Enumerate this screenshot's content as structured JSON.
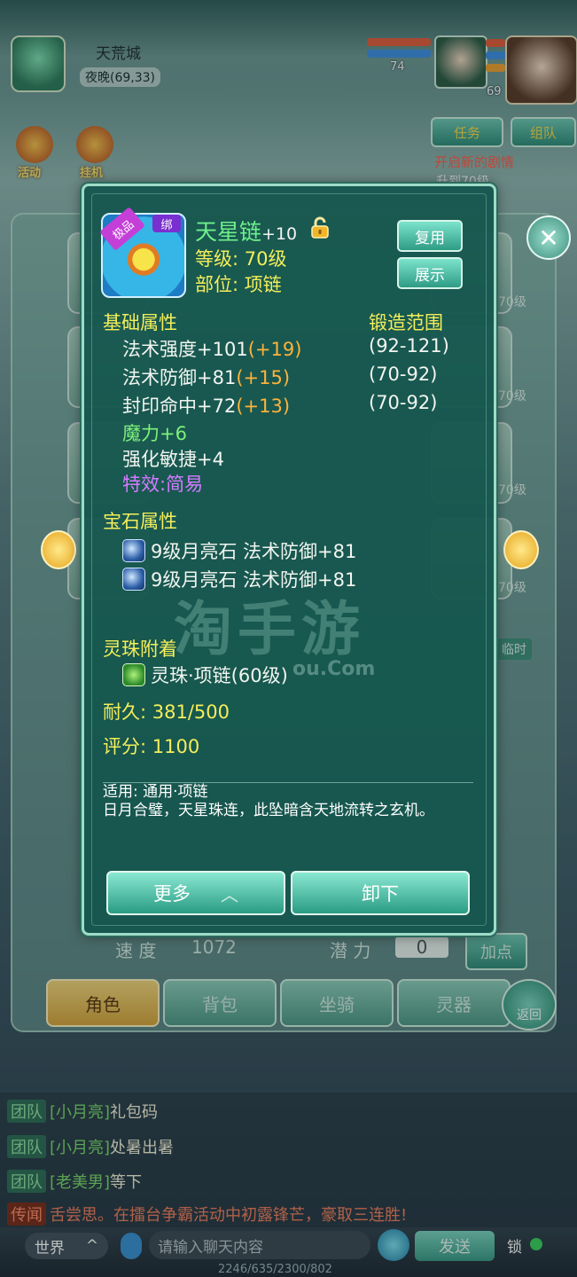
{
  "hud": {
    "city_name": "天荒城",
    "city_time": "夜晚(69,33)",
    "pet_level": "74",
    "hero_level": "69",
    "quest_btn_task": "任务",
    "quest_btn_team": "组队",
    "quest_title": "开启新的剧情",
    "quest_sub": "升到70级",
    "left_icon_1": "活动",
    "left_icon_2": "挂机"
  },
  "background_panel": {
    "slot_levels": [
      "70级",
      "70级",
      "70级",
      "70级"
    ],
    "stats": [
      {
        "label": "速 度",
        "value": "1072"
      },
      {
        "label": "潜 力",
        "value": "0"
      }
    ],
    "add_points_label": "加点",
    "temp_label": "临时",
    "tabs": [
      "角色",
      "背包",
      "坐骑",
      "灵器"
    ],
    "back_label": "返回"
  },
  "tooltip": {
    "rarity_tag": "极品",
    "bind_tag": "绑",
    "item_name": "天星链",
    "item_enhance": "+10",
    "level_line": "等级: 70级",
    "slot_line": "部位: 项链",
    "btn_reuse": "复用",
    "btn_show": "展示",
    "base_title": "基础属性",
    "forge_title": "锻造范围",
    "base_attrs": [
      {
        "text": "法术强度+101",
        "bonus": "(+19)",
        "range": "(92-121)"
      },
      {
        "text": "法术防御+81",
        "bonus": "(+15)",
        "range": "(70-92)"
      },
      {
        "text": "封印命中+72",
        "bonus": "(+13)",
        "range": "(70-92)"
      }
    ],
    "extra_magic": "魔力+6",
    "extra_agility": "强化敏捷+4",
    "special_effect": "特效:简易",
    "gem_title": "宝石属性",
    "gems": [
      "9级月亮石 法术防御+81",
      "9级月亮石 法术防御+81"
    ],
    "bead_title": "灵珠附着",
    "bead": "灵珠·项链(60级)",
    "durability": "耐久: 381/500",
    "score": "评分: 1100",
    "usage": "适用: 通用·项链",
    "description": "日月合璧，天星珠连，此坠暗含天地流转之玄机。",
    "btn_more": "更多",
    "btn_unequip": "卸下"
  },
  "watermark": {
    "main": "淘手游",
    "sub": "ou.Com"
  },
  "chat": {
    "lines": [
      {
        "channel": "团队",
        "name": "[小月亮]",
        "msg": "礼包码"
      },
      {
        "channel": "团队",
        "name": "[小月亮]",
        "msg": "处暑出暑"
      },
      {
        "channel": "团队",
        "name": "[老美男]",
        "msg": "等下"
      },
      {
        "channel": "传闻",
        "name": "",
        "msg": "舌尝思。在擂台争霸活动中初露锋芒，豪取三连胜!"
      }
    ],
    "world_label": "世界",
    "input_placeholder": "请输入聊天内容",
    "send_label": "发送",
    "lock_label": "锁",
    "coords": "2246/635/2300/802"
  },
  "colors": {
    "tooltip_bg": "#14564e",
    "title_yellow": "#f4ee5a",
    "attr_green": "#7ef07a",
    "bonus_orange": "#ffb23a",
    "effect_purple": "#d47bff"
  }
}
